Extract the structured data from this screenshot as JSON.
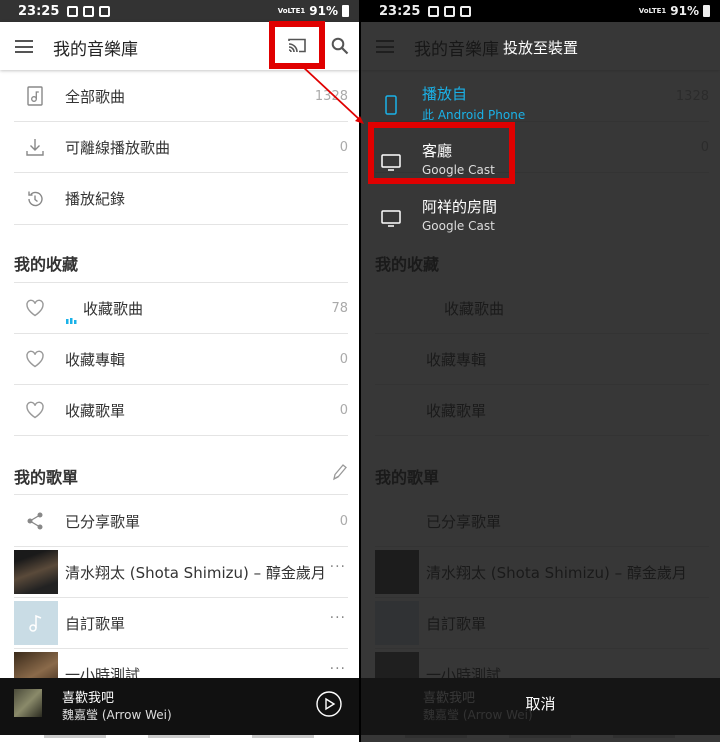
{
  "status": {
    "time": "23:25",
    "signal": "VoLTE1",
    "battery": "91%"
  },
  "library": {
    "title": "我的音樂庫",
    "rows": [
      {
        "label": "全部歌曲",
        "count": "1328"
      },
      {
        "label": "可離線播放歌曲",
        "count": "0"
      },
      {
        "label": "播放紀錄",
        "count": ""
      }
    ],
    "fav_header": "我的收藏",
    "fav_rows": [
      {
        "label": "收藏歌曲",
        "count": "78"
      },
      {
        "label": "收藏專輯",
        "count": "0"
      },
      {
        "label": "收藏歌單",
        "count": "0"
      }
    ],
    "pl_header": "我的歌單",
    "shared": {
      "label": "已分享歌單",
      "count": "0"
    },
    "playlists": [
      {
        "label": "清水翔太 (Shota Shimizu) – 醇金歲月"
      },
      {
        "label": "自訂歌單"
      },
      {
        "label": "一小時測試"
      }
    ],
    "more": "···"
  },
  "now_playing": {
    "title": "喜歡我吧",
    "artist": "魏嘉瑩 (Arrow Wei)"
  },
  "dialog": {
    "title": "投放至裝置",
    "devices": [
      {
        "name": "播放自",
        "sub": "此 Android Phone",
        "active": true
      },
      {
        "name": "客廳",
        "sub": "Google Cast"
      },
      {
        "name": "阿祥的房間",
        "sub": "Google Cast"
      }
    ],
    "cancel": "取消"
  },
  "colors": {
    "accent": "#1ab2e8",
    "highlight": "#e00000",
    "dialog_bg": "#222222"
  }
}
